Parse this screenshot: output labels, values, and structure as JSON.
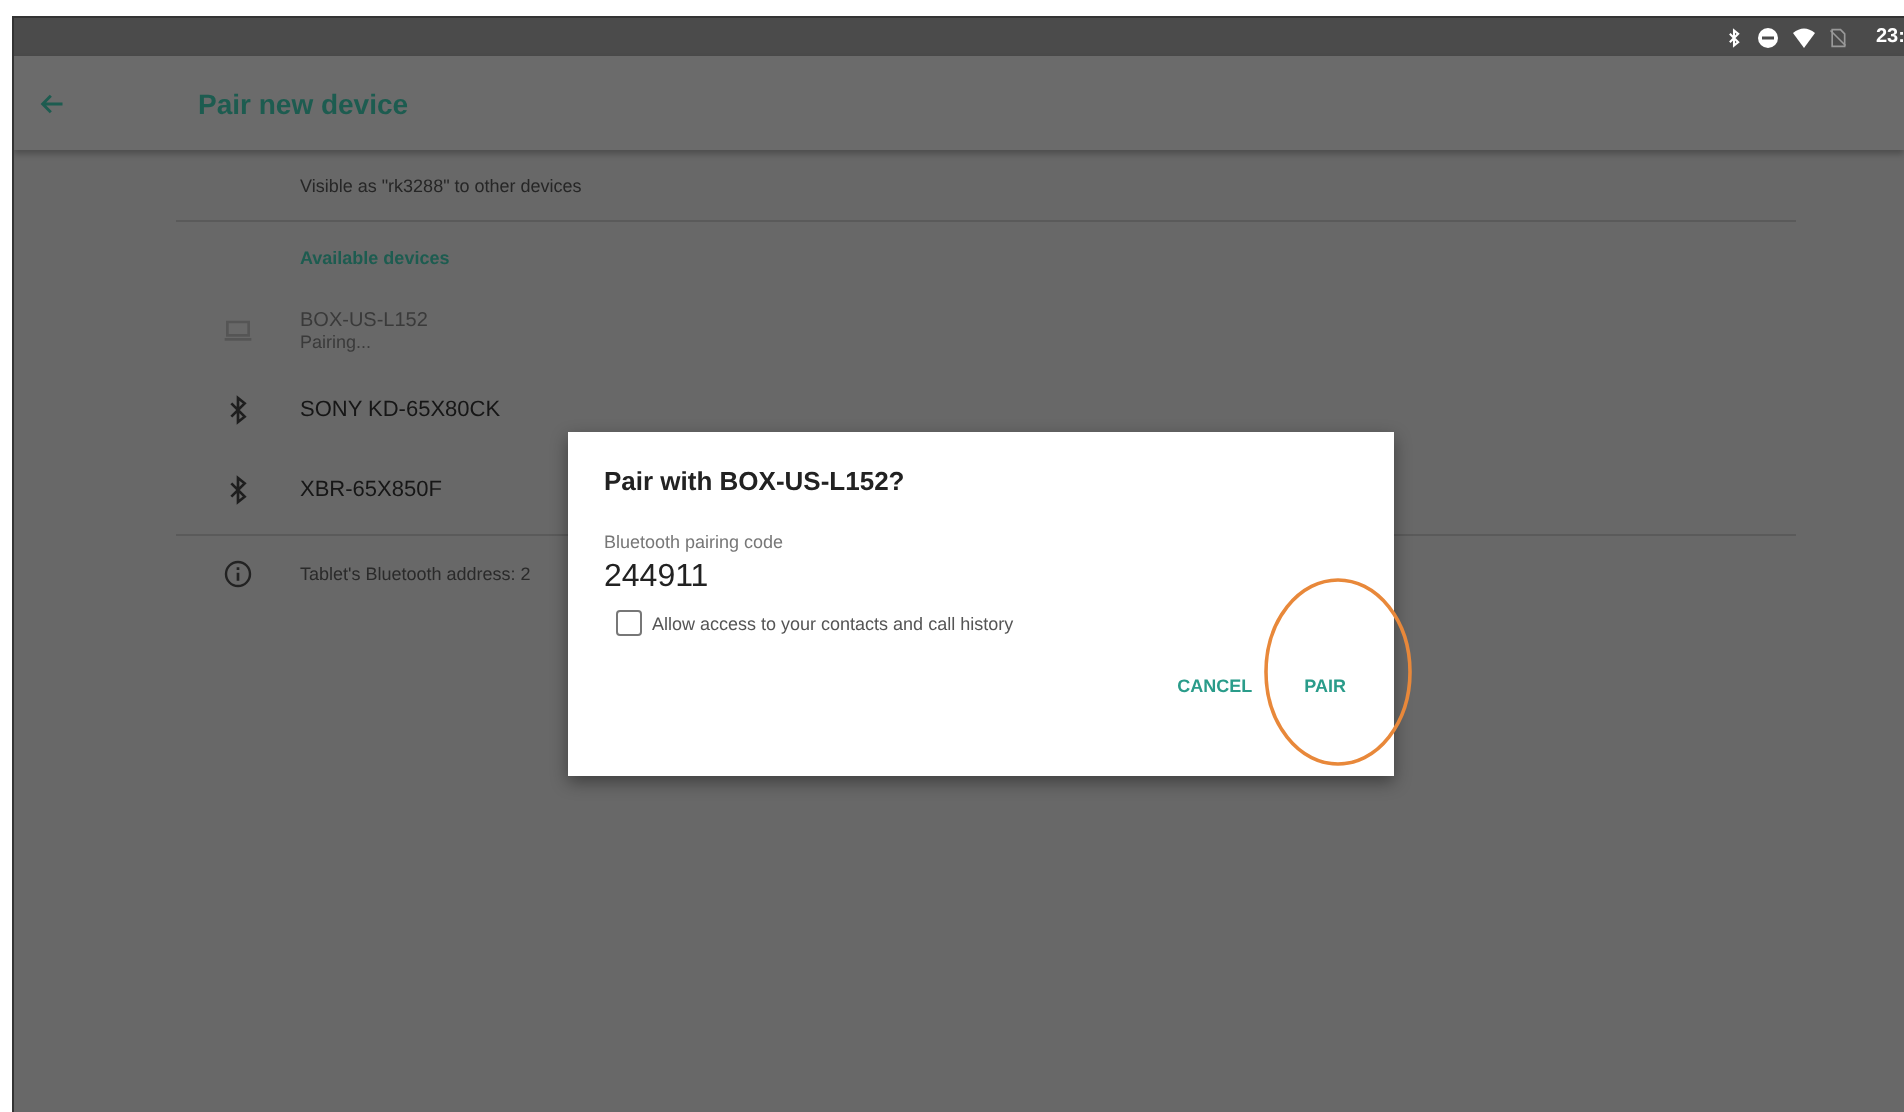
{
  "status_bar": {
    "time": "23:"
  },
  "app_bar": {
    "title": "Pair new device"
  },
  "visible_as": "Visible as \"rk3288\" to other devices",
  "section_header": "Available devices",
  "devices": [
    {
      "kind": "laptop",
      "name": "BOX-US-L152",
      "subtitle": "Pairing...",
      "disabled": true
    },
    {
      "kind": "bluetooth",
      "name": "SONY KD-65X80CK",
      "disabled": false
    },
    {
      "kind": "bluetooth",
      "name": "XBR-65X850F",
      "disabled": false
    }
  ],
  "info": "Tablet's Bluetooth address: 2",
  "dialog": {
    "title": "Pair with BOX-US-L152?",
    "code_label": "Bluetooth pairing code",
    "code": "244911",
    "checkbox": {
      "label": "Allow access to your contacts and call history",
      "checked": false
    },
    "buttons": [
      {
        "label": "CANCEL",
        "highlighted": false
      },
      {
        "label": "PAIR",
        "highlighted": true
      }
    ]
  }
}
